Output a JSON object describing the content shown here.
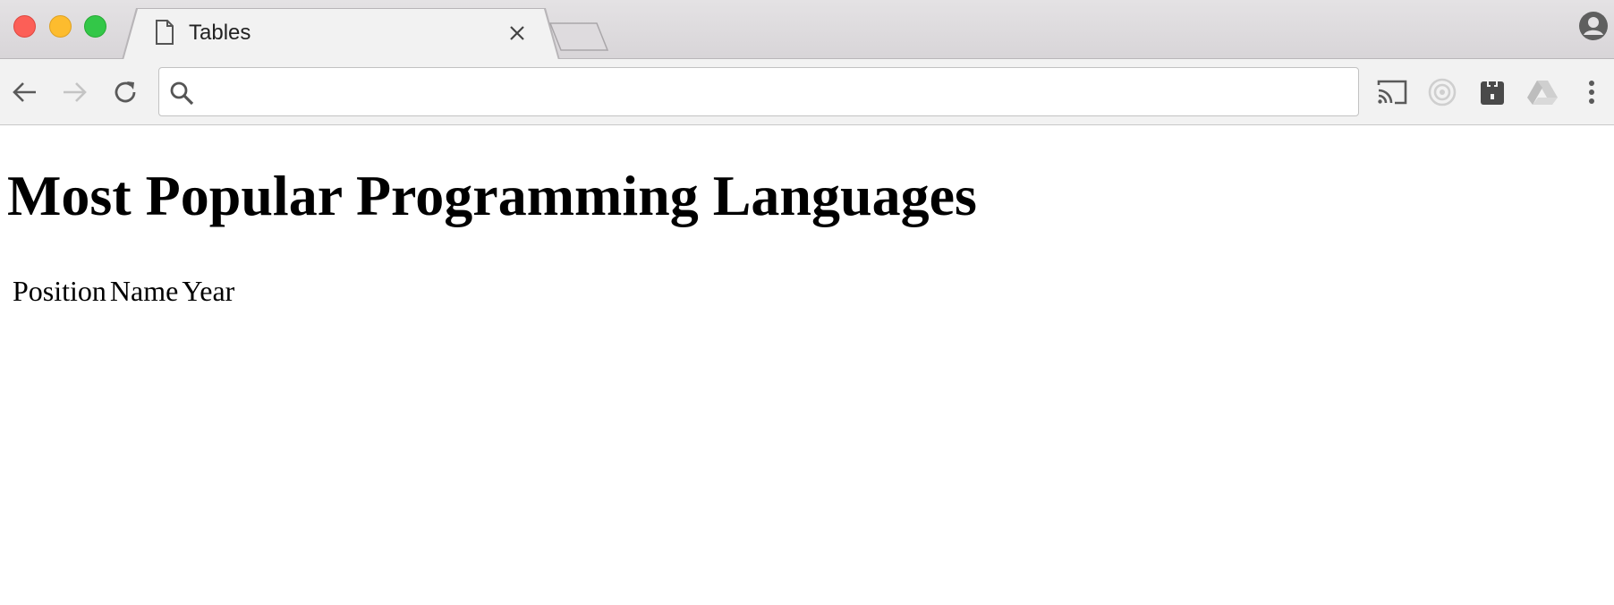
{
  "window": {
    "tab_title": "Tables"
  },
  "toolbar": {
    "address_value": "",
    "address_placeholder": ""
  },
  "page": {
    "heading": "Most Popular Programming Languages",
    "table": {
      "headers": [
        "Position",
        "Name",
        "Year"
      ],
      "rows": []
    }
  },
  "icons": {
    "tab": "document-icon",
    "tab_close": "close-icon",
    "back": "back-arrow-icon",
    "forward": "forward-arrow-icon",
    "reload": "reload-icon",
    "search": "search-icon",
    "cast": "cast-icon",
    "ext1": "radar-icon",
    "ext2": "plug-icon",
    "ext3": "drive-icon",
    "menu": "kebab-menu-icon",
    "profile": "profile-icon"
  },
  "colors": {
    "close_btn": "#fc5f57",
    "minimize_btn": "#fdbc2e",
    "maximize_btn": "#33c748",
    "chrome_bg": "#f2f2f2"
  }
}
